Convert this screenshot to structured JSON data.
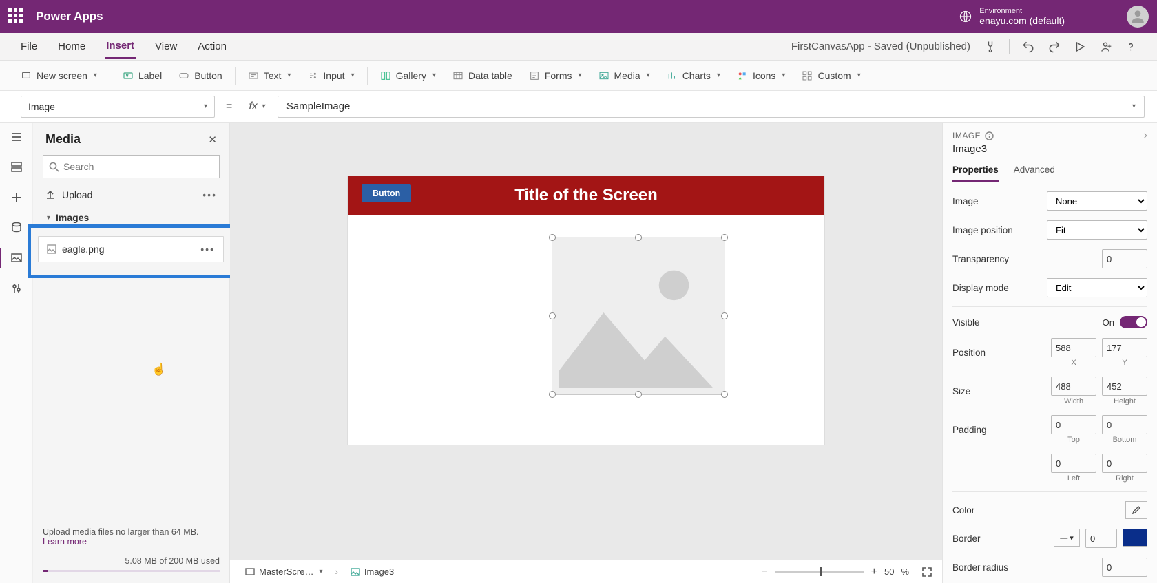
{
  "topbar": {
    "app": "Power Apps",
    "env_label": "Environment",
    "env_value": "enayu.com (default)"
  },
  "menu": {
    "items": [
      "File",
      "Home",
      "Insert",
      "View",
      "Action"
    ],
    "active": "Insert",
    "doc_status": "FirstCanvasApp - Saved (Unpublished)"
  },
  "ribbon": {
    "new_screen": "New screen",
    "label": "Label",
    "button": "Button",
    "text": "Text",
    "input": "Input",
    "gallery": "Gallery",
    "data_table": "Data table",
    "forms": "Forms",
    "media": "Media",
    "charts": "Charts",
    "icons": "Icons",
    "custom": "Custom"
  },
  "formula": {
    "property": "Image",
    "value": "SampleImage"
  },
  "media_panel": {
    "title": "Media",
    "search_placeholder": "Search",
    "upload": "Upload",
    "section": "Images",
    "file": "eagle.png",
    "footer_text": "Upload media files no larger than 64 MB.",
    "learn": "Learn more",
    "usage": "5.08 MB of 200 MB used"
  },
  "canvas": {
    "button_label": "Button",
    "screen_title": "Title of the Screen"
  },
  "status": {
    "screen": "MasterScre…",
    "control": "Image3",
    "zoom": "50",
    "zoom_unit": "%"
  },
  "props": {
    "type": "IMAGE",
    "name": "Image3",
    "tab_properties": "Properties",
    "tab_advanced": "Advanced",
    "image": "Image",
    "image_val": "None",
    "image_position": "Image position",
    "image_position_val": "Fit",
    "transparency": "Transparency",
    "transparency_val": "0",
    "display_mode": "Display mode",
    "display_mode_val": "Edit",
    "visible": "Visible",
    "visible_state": "On",
    "position": "Position",
    "pos_x": "588",
    "pos_x_lbl": "X",
    "pos_y": "177",
    "pos_y_lbl": "Y",
    "size": "Size",
    "size_w": "488",
    "size_w_lbl": "Width",
    "size_h": "452",
    "size_h_lbl": "Height",
    "padding": "Padding",
    "pad_top": "0",
    "pad_top_lbl": "Top",
    "pad_bottom": "0",
    "pad_bottom_lbl": "Bottom",
    "pad_left": "0",
    "pad_left_lbl": "Left",
    "pad_right": "0",
    "pad_right_lbl": "Right",
    "color": "Color",
    "border": "Border",
    "border_val": "0",
    "border_radius": "Border radius",
    "border_radius_val": "0"
  }
}
